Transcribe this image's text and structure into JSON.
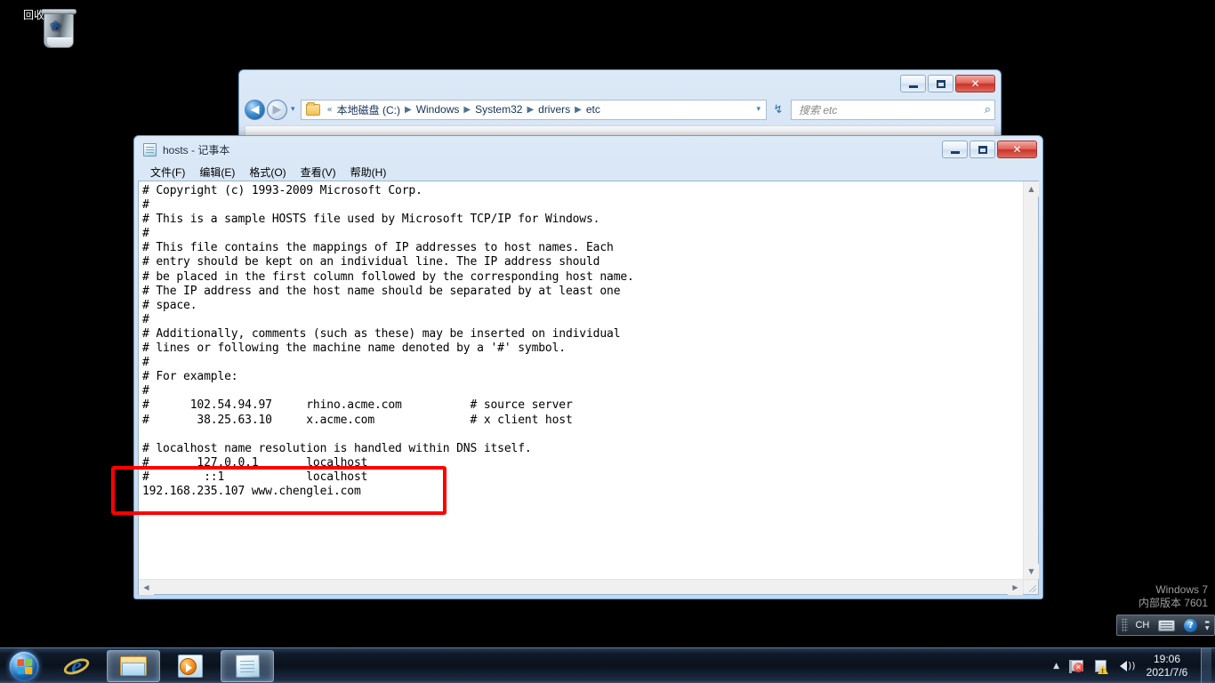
{
  "desktop": {
    "icons": [
      {
        "name": "recycle-bin",
        "label": "回收站"
      }
    ],
    "watermark_line1": "Windows 7",
    "watermark_line2": "内部版本 7601"
  },
  "explorer": {
    "window_title": "",
    "breadcrumb": {
      "prefix": "«",
      "items": [
        "本地磁盘 (C:)",
        "Windows",
        "System32",
        "drivers",
        "etc"
      ],
      "separator": "▶"
    },
    "search": {
      "placeholder": "搜索 etc"
    },
    "buttons": {
      "back": "◀",
      "forward": "▶",
      "recent_dropdown": "▾",
      "refresh": "↯",
      "address_dropdown": "▾",
      "search_icon": "⌕"
    },
    "window_controls": {
      "minimize": "—",
      "maximize": "❐",
      "close": "✕"
    }
  },
  "notepad": {
    "title": "hosts - 记事本",
    "menu": [
      {
        "name": "file",
        "label": "文件(F)"
      },
      {
        "name": "edit",
        "label": "编辑(E)"
      },
      {
        "name": "format",
        "label": "格式(O)"
      },
      {
        "name": "view",
        "label": "查看(V)"
      },
      {
        "name": "help",
        "label": "帮助(H)"
      }
    ],
    "window_controls": {
      "minimize": "—",
      "restore": "❐",
      "close": "✕"
    },
    "scroll": {
      "up": "▲",
      "down": "▼",
      "left": "◀",
      "right": "▶"
    },
    "content": "# Copyright (c) 1993-2009 Microsoft Corp.\n#\n# This is a sample HOSTS file used by Microsoft TCP/IP for Windows.\n#\n# This file contains the mappings of IP addresses to host names. Each\n# entry should be kept on an individual line. The IP address should\n# be placed in the first column followed by the corresponding host name.\n# The IP address and the host name should be separated by at least one\n# space.\n#\n# Additionally, comments (such as these) may be inserted on individual\n# lines or following the machine name denoted by a '#' symbol.\n#\n# For example:\n#\n#      102.54.94.97     rhino.acme.com          # source server\n#       38.25.63.10     x.acme.com              # x client host\n\n# localhost name resolution is handled within DNS itself.\n#       127.0.0.1       localhost\n#        ::1            localhost\n192.168.235.107 www.chenglei.com"
  },
  "annotation": {
    "color": "#fe0000",
    "highlighted_lines": [
      "#        ::1            localhost",
      "192.168.235.107 www.chenglei.com"
    ]
  },
  "taskbar": {
    "start_label": "开始",
    "buttons": [
      {
        "name": "internet-explorer",
        "label": "Internet Explorer",
        "active": false
      },
      {
        "name": "windows-explorer",
        "label": "Windows 资源管理器",
        "active": true
      },
      {
        "name": "windows-media-player",
        "label": "Windows Media Player",
        "active": false
      },
      {
        "name": "notepad",
        "label": "hosts - 记事本",
        "active": true
      }
    ],
    "tray": {
      "chevron": "▲",
      "items": [
        {
          "name": "network-status-icon",
          "label": "网络"
        },
        {
          "name": "action-center-icon",
          "label": "操作中心"
        },
        {
          "name": "volume-icon",
          "label": "音量"
        }
      ]
    },
    "clock": {
      "time": "19:06",
      "date": "2021/7/6"
    }
  },
  "ime": {
    "language": "CH",
    "keyboard_icon": "keyboard-icon",
    "help_icon": "?",
    "minimize_arrow": "▬",
    "expand_arrow": "▼"
  }
}
